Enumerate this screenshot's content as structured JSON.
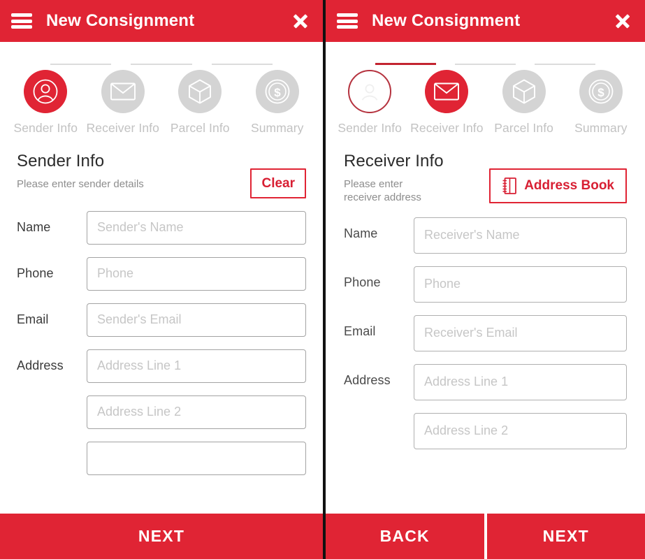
{
  "brand": {
    "red": "#e02434",
    "red_dark": "#c32430",
    "grey_step": "#d4d4d4",
    "label_grey": "#c2c2c2"
  },
  "screens": [
    {
      "id": "sender",
      "appbar": {
        "menu_icon": "hamburger-icon",
        "title": "New Consignment",
        "close_icon": "close-icon"
      },
      "stepper": {
        "steps": [
          {
            "icon": "person-icon",
            "label": "Sender Info",
            "state": "active"
          },
          {
            "icon": "envelope-icon",
            "label": "Receiver Info",
            "state": "pending"
          },
          {
            "icon": "cube-icon",
            "label": "Parcel Info",
            "state": "pending"
          },
          {
            "icon": "coin-dollar-icon",
            "label": "Summary",
            "state": "pending"
          }
        ]
      },
      "section": {
        "title": "Sender Info",
        "subtitle": "Please enter sender details",
        "action_label": "Clear",
        "action_icon": null
      },
      "fields": [
        {
          "label": "Name",
          "placeholder": "Sender's Name",
          "value": ""
        },
        {
          "label": "Phone",
          "placeholder": "Phone",
          "value": ""
        },
        {
          "label": "Email",
          "placeholder": "Sender's Email",
          "value": ""
        },
        {
          "label": "Address",
          "placeholder": "Address Line 1",
          "value": ""
        },
        {
          "label": "",
          "placeholder": "Address Line 2",
          "value": ""
        },
        {
          "label": "",
          "placeholder": "",
          "value": ""
        }
      ],
      "bottom_buttons": [
        {
          "label": "NEXT"
        }
      ]
    },
    {
      "id": "receiver",
      "appbar": {
        "menu_icon": "hamburger-icon",
        "title": "New Consignment",
        "close_icon": "close-icon"
      },
      "stepper": {
        "steps": [
          {
            "icon": "person-icon",
            "label": "Sender Info",
            "state": "done"
          },
          {
            "icon": "envelope-icon",
            "label": "Receiver Info",
            "state": "active"
          },
          {
            "icon": "cube-icon",
            "label": "Parcel Info",
            "state": "pending"
          },
          {
            "icon": "coin-dollar-icon",
            "label": "Summary",
            "state": "pending"
          }
        ]
      },
      "section": {
        "title": "Receiver Info",
        "subtitle": "Please enter receiver address",
        "action_label": "Address Book",
        "action_icon": "address-book-icon"
      },
      "fields": [
        {
          "label": "Name",
          "placeholder": "Receiver's Name",
          "value": ""
        },
        {
          "label": "Phone",
          "placeholder": "Phone",
          "value": ""
        },
        {
          "label": "Email",
          "placeholder": "Receiver's Email",
          "value": ""
        },
        {
          "label": "Address",
          "placeholder": "Address Line 1",
          "value": ""
        },
        {
          "label": "",
          "placeholder": "Address Line 2",
          "value": ""
        }
      ],
      "bottom_buttons": [
        {
          "label": "BACK"
        },
        {
          "label": "NEXT"
        }
      ]
    }
  ]
}
